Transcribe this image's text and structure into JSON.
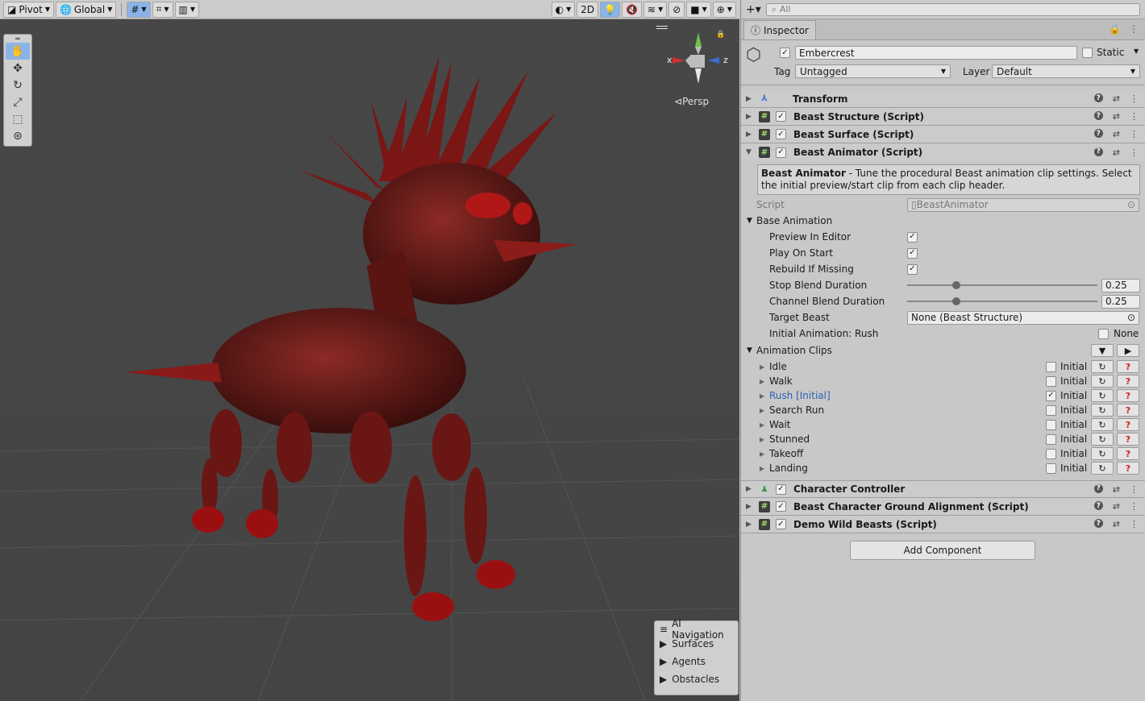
{
  "toolbar": {
    "pivot": "Pivot",
    "global": "Global",
    "mode2d": "2D"
  },
  "scene": {
    "persp": "Persp",
    "gizmo_x": "x",
    "gizmo_z": "z",
    "ainav": {
      "title": "AI Navigation",
      "items": [
        "Surfaces",
        "Agents",
        "Obstacles"
      ]
    }
  },
  "inspector": {
    "search_placeholder": "All",
    "tab": "Inspector",
    "object": {
      "name": "Embercrest",
      "static_label": "Static",
      "tag_label": "Tag",
      "tag_value": "Untagged",
      "layer_label": "Layer",
      "layer_value": "Default"
    },
    "components_top": [
      "Transform",
      "Beast Structure (Script)",
      "Beast Surface (Script)",
      "Beast Animator (Script)"
    ],
    "help_title": "Beast Animator",
    "help_text": " - Tune the procedural Beast animation clip settings. Select the initial preview/start clip from each clip header.",
    "script_label": "Script",
    "script_value": "BeastAnimator",
    "base_animation": "Base Animation",
    "preview_in_editor": "Preview In Editor",
    "play_on_start": "Play On Start",
    "rebuild_if_missing": "Rebuild If Missing",
    "stop_blend": "Stop Blend Duration",
    "stop_blend_value": "0.25",
    "channel_blend": "Channel Blend Duration",
    "channel_blend_value": "0.25",
    "target_beast": "Target Beast",
    "target_beast_value": "None (Beast Structure)",
    "initial_anim": "Initial Animation: Rush",
    "none_label": "None",
    "animation_clips": "Animation Clips",
    "initial_label": "Initial",
    "clips": [
      "Idle",
      "Walk",
      "Rush  [Initial]",
      "Search Run",
      "Wait",
      "Stunned",
      "Takeoff",
      "Landing"
    ],
    "components_bottom": [
      "Character Controller",
      "Beast Character Ground Alignment (Script)",
      "Demo Wild Beasts (Script)"
    ],
    "add_component": "Add Component"
  }
}
